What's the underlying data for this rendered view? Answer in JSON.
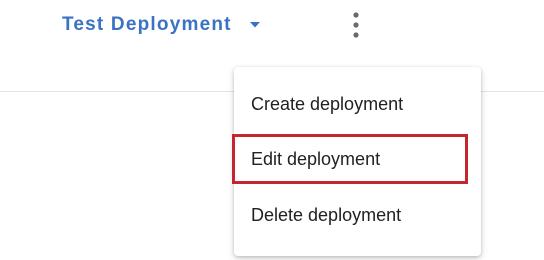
{
  "toolbar": {
    "deployment_label": "Test Deployment",
    "caret_icon": "caret-down-icon",
    "more_icon": "more-vertical-icon"
  },
  "menu": {
    "items": [
      {
        "label": "Create deployment"
      },
      {
        "label": "Edit deployment"
      },
      {
        "label": "Delete deployment"
      }
    ],
    "highlighted_index": 1
  },
  "colors": {
    "accent": "#3a72c4",
    "highlight_border": "#c5262e",
    "menu_text": "#212121",
    "divider": "#e3e3e3"
  }
}
